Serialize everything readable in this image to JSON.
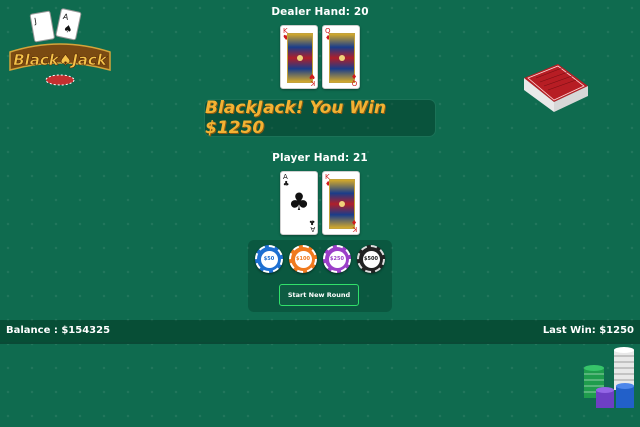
{
  "logo": {
    "text": "BlackJack"
  },
  "dealer": {
    "title": "Dealer Hand: 20",
    "cards": [
      {
        "rank": "K",
        "suit": "♥",
        "color": "#d11b1b"
      },
      {
        "rank": "Q",
        "suit": "♦",
        "color": "#d11b1b"
      }
    ]
  },
  "result": {
    "message": "BlackJack! You Win $1250"
  },
  "player": {
    "title": "Player Hand: 21",
    "cards": [
      {
        "rank": "A",
        "suit": "♣",
        "color": "#111111"
      },
      {
        "rank": "K",
        "suit": "♦",
        "color": "#d11b1b"
      }
    ]
  },
  "chips": [
    {
      "label": "$50",
      "color": "#1d6fd1"
    },
    {
      "label": "$100",
      "color": "#f07a1e"
    },
    {
      "label": "$250",
      "color": "#9b3fc8"
    },
    {
      "label": "$500",
      "color": "#222222"
    }
  ],
  "actions": {
    "new_round": "Start New Round"
  },
  "status": {
    "balance": "Balance : $154325",
    "last_win": "Last Win: $1250"
  },
  "colors": {
    "table_green": "#0f6b4f",
    "banner_gold": "#f3b233",
    "button_border": "#31e06a"
  }
}
